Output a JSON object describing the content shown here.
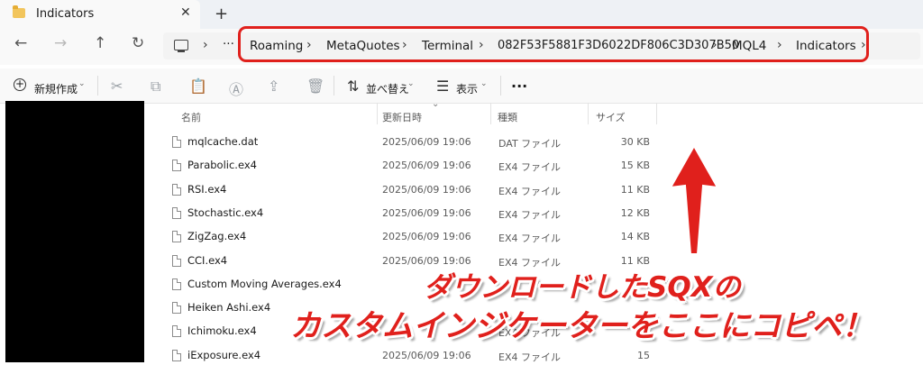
{
  "tab": {
    "title": "Indicators",
    "close": "✕",
    "add": "+"
  },
  "nav": {
    "back": "←",
    "forward": "→",
    "up": "↑",
    "refresh": "↻",
    "more": "···",
    "chevron": "›"
  },
  "breadcrumb": [
    "Roaming",
    "MetaQuotes",
    "Terminal",
    "082F53F5881F3D6022DF806C3D307B50",
    "MQL4",
    "Indicators"
  ],
  "toolbar": {
    "new_label": "新規作成",
    "sort_label": "並べ替え",
    "view_label": "表示",
    "more": "···"
  },
  "columns": {
    "name": "名前",
    "date": "更新日時",
    "type": "種類",
    "size": "サイズ"
  },
  "files": [
    {
      "name": "mqlcache.dat",
      "date": "2025/06/09 19:06",
      "type": "DAT ファイル",
      "size": "30 KB"
    },
    {
      "name": "Parabolic.ex4",
      "date": "2025/06/09 19:06",
      "type": "EX4 ファイル",
      "size": "15 KB"
    },
    {
      "name": "RSI.ex4",
      "date": "2025/06/09 19:06",
      "type": "EX4 ファイル",
      "size": "11 KB"
    },
    {
      "name": "Stochastic.ex4",
      "date": "2025/06/09 19:06",
      "type": "EX4 ファイル",
      "size": "12 KB"
    },
    {
      "name": "ZigZag.ex4",
      "date": "2025/06/09 19:06",
      "type": "EX4 ファイル",
      "size": "14 KB"
    },
    {
      "name": "CCI.ex4",
      "date": "2025/06/09 19:06",
      "type": "EX4 ファイル",
      "size": "11 KB"
    },
    {
      "name": "Custom Moving Averages.ex4",
      "date": "",
      "type": "",
      "size": ""
    },
    {
      "name": "Heiken Ashi.ex4",
      "date": "",
      "type": "",
      "size": ""
    },
    {
      "name": "Ichimoku.ex4",
      "date": "",
      "type": "EX4 ファイル",
      "size": "15"
    },
    {
      "name": "iExposure.ex4",
      "date": "2025/06/09 19:06",
      "type": "EX4 ファイル",
      "size": "15"
    }
  ],
  "annotation": {
    "line1": "ダウンロードしたSQXの",
    "line2": "カスタムインジケーターをここにコピペ！"
  },
  "colors": {
    "highlight": "#e0201c",
    "arrow": "#e0201c"
  }
}
